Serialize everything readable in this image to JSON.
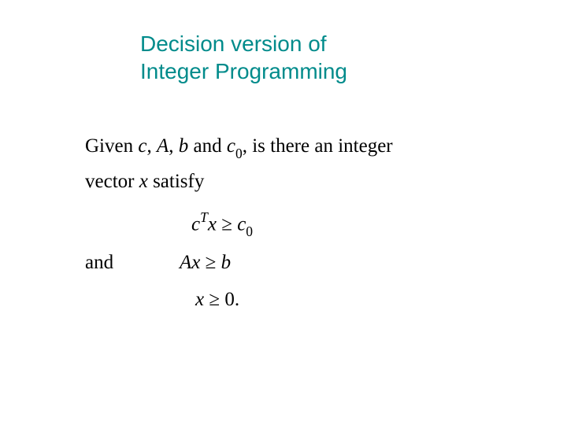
{
  "title": {
    "line1": "Decision version of",
    "line2": "Integer Programming"
  },
  "body": {
    "givenPrefix": "Given ",
    "c": "c",
    "comma1": ", ",
    "A": "A",
    "comma2": ", ",
    "b": "b",
    "andWord1": " and ",
    "c0_c": "c",
    "c0_sub": "0",
    "givenSuffix": ", is there an integer",
    "line2a": "vector ",
    "x": "x",
    "line2b": " satisfy",
    "and": "and",
    "expr1_c": "c",
    "expr1_T": "T",
    "expr1_x": "x",
    "expr1_ge": " ≥ ",
    "expr1_c2": "c",
    "expr1_sub": "0",
    "expr2_A": "A",
    "expr2_x": "x",
    "expr2_ge": " ≥ ",
    "expr2_b": "b",
    "expr3_x": "x",
    "expr3_ge": " ≥ ",
    "expr3_zero": "0."
  }
}
